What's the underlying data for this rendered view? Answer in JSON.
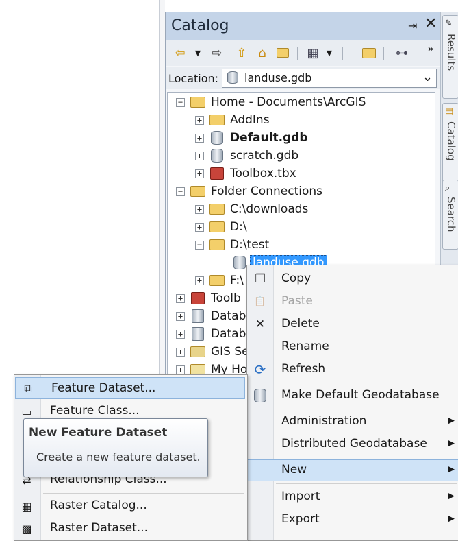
{
  "catalog": {
    "title": "Catalog",
    "pin_glyph": "⇥",
    "close_glyph": "✕",
    "location_label": "Location:",
    "location_value": "landuse.gdb",
    "toolbar_overflow": "»"
  },
  "side_tabs": [
    "Results",
    "Catalog",
    "Search"
  ],
  "tree": {
    "items": [
      {
        "label": "Home - Documents\\ArcGIS",
        "exp": "⊟"
      },
      {
        "label": "AddIns",
        "exp": "⊞"
      },
      {
        "label": "Default.gdb",
        "exp": "⊞"
      },
      {
        "label": "scratch.gdb",
        "exp": "⊞"
      },
      {
        "label": "Toolbox.tbx",
        "exp": "⊞"
      },
      {
        "label": "Folder Connections",
        "exp": "⊟"
      },
      {
        "label": "C:\\downloads",
        "exp": "⊞"
      },
      {
        "label": "D:\\",
        "exp": "⊞"
      },
      {
        "label": "D:\\test",
        "exp": "⊟"
      },
      {
        "label": "landuse.gdb",
        "exp": ""
      },
      {
        "label": "F:\\",
        "exp": "⊞"
      },
      {
        "label": "Toolb",
        "exp": "⊞"
      },
      {
        "label": "Datab",
        "exp": "⊞"
      },
      {
        "label": "Datab",
        "exp": "⊞"
      },
      {
        "label": "GIS Se",
        "exp": "⊞"
      },
      {
        "label": "My Ho",
        "exp": "⊞"
      }
    ]
  },
  "context_menu": {
    "items": [
      {
        "label": "Copy"
      },
      {
        "label": "Paste"
      },
      {
        "label": "Delete"
      },
      {
        "label": "Rename"
      },
      {
        "label": "Refresh"
      },
      {
        "label": "Make Default Geodatabase"
      },
      {
        "label": "Administration"
      },
      {
        "label": "Distributed Geodatabase"
      },
      {
        "label": "New"
      },
      {
        "label": "Import"
      },
      {
        "label": "Export"
      }
    ],
    "arrow": "▶"
  },
  "new_submenu": {
    "items": [
      {
        "label": "Feature Dataset..."
      },
      {
        "label": "Feature Class..."
      },
      {
        "label": "Relationship Class..."
      },
      {
        "label": "Raster Catalog..."
      },
      {
        "label": "Raster Dataset..."
      }
    ]
  },
  "tooltip": {
    "title": "New Feature Dataset",
    "body": "Create a new feature dataset."
  },
  "icons": {
    "delete": "✕",
    "refresh": "⟳",
    "copy": "❐",
    "paste": "📋"
  }
}
